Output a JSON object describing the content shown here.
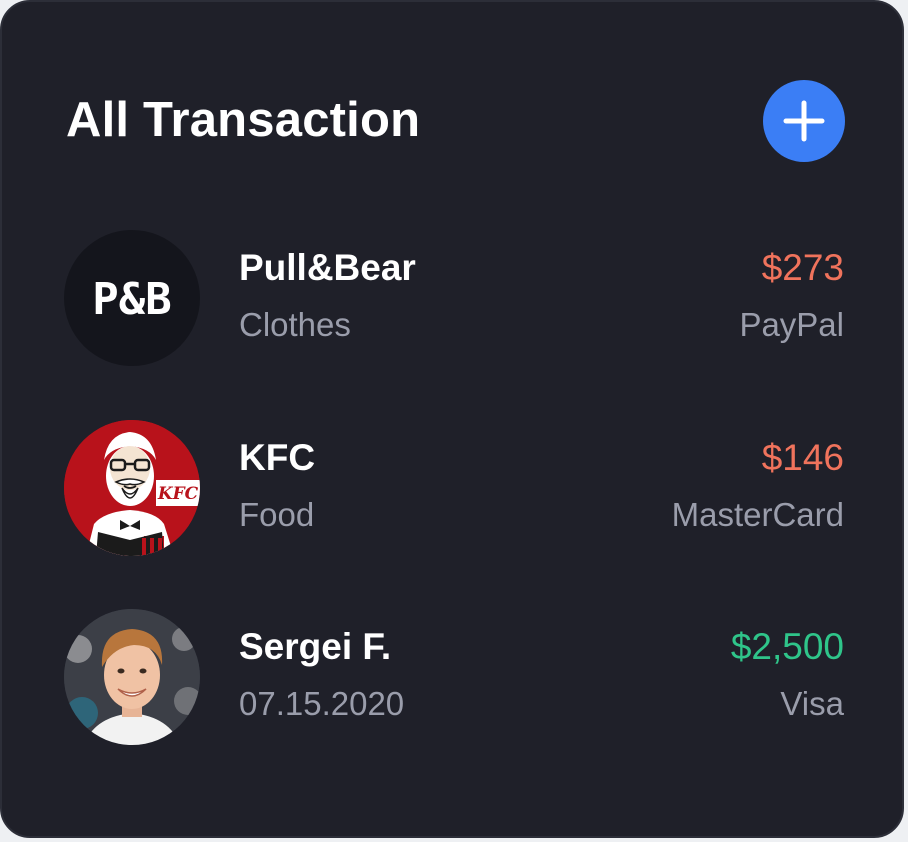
{
  "header": {
    "title": "All Transaction",
    "add_icon": "plus-icon",
    "accent_color": "#3b7ef5"
  },
  "transactions": [
    {
      "name": "Pull&Bear",
      "subtitle": "Clothes",
      "amount": "$273",
      "method": "PayPal",
      "direction": "expense",
      "avatar": "pullandbear-logo",
      "logo_text": "P&B"
    },
    {
      "name": "KFC",
      "subtitle": "Food",
      "amount": "$146",
      "method": "MasterCard",
      "direction": "expense",
      "avatar": "kfc-logo",
      "logo_text": "KFC"
    },
    {
      "name": "Sergei F.",
      "subtitle": "07.15.2020",
      "amount": "$2,500",
      "method": "Visa",
      "direction": "income",
      "avatar": "user-photo"
    }
  ],
  "colors": {
    "expense": "#f0735c",
    "income": "#2fc58a",
    "card_background": "#1f2029"
  }
}
